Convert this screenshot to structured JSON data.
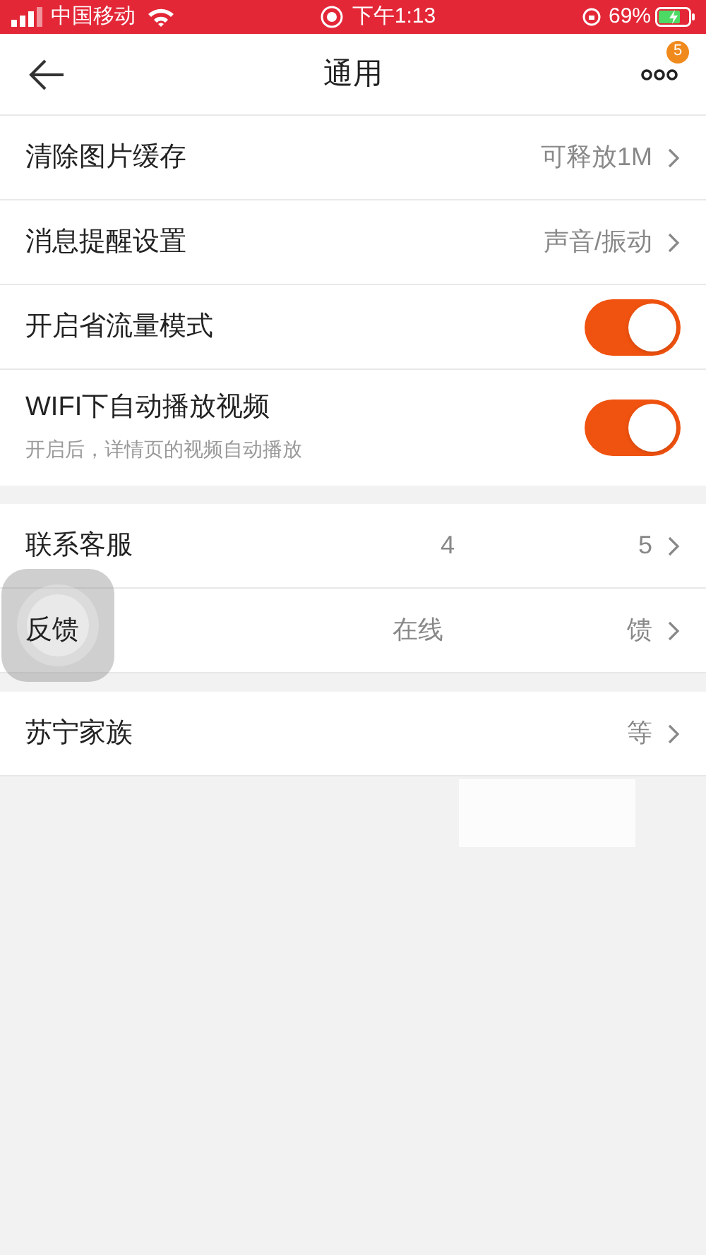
{
  "status_bar": {
    "carrier": "中国移动",
    "time": "下午1:13",
    "battery": "69%"
  },
  "header": {
    "title": "通用",
    "badge": "5"
  },
  "sections": [
    {
      "rows": [
        {
          "kind": "value",
          "label": "清除图片缓存",
          "value": "可释放1M"
        },
        {
          "kind": "value",
          "label": "消息提醒设置",
          "value": "声音/振动"
        },
        {
          "kind": "toggle",
          "label": "开启省流量模式",
          "on": true
        },
        {
          "kind": "toggle",
          "label": "WIFI下自动播放视频",
          "subtitle": "开启后，详情页的视频自动播放",
          "on": true
        }
      ]
    },
    {
      "rows": [
        {
          "kind": "redacted",
          "label": "联系客服",
          "value_start": "4",
          "value_end": "5"
        },
        {
          "kind": "redacted",
          "label": "反馈",
          "value_start": "在线",
          "value_end": "馈"
        }
      ]
    },
    {
      "rows": [
        {
          "kind": "redacted",
          "label": "苏宁家族",
          "value_end": "等"
        }
      ]
    }
  ]
}
